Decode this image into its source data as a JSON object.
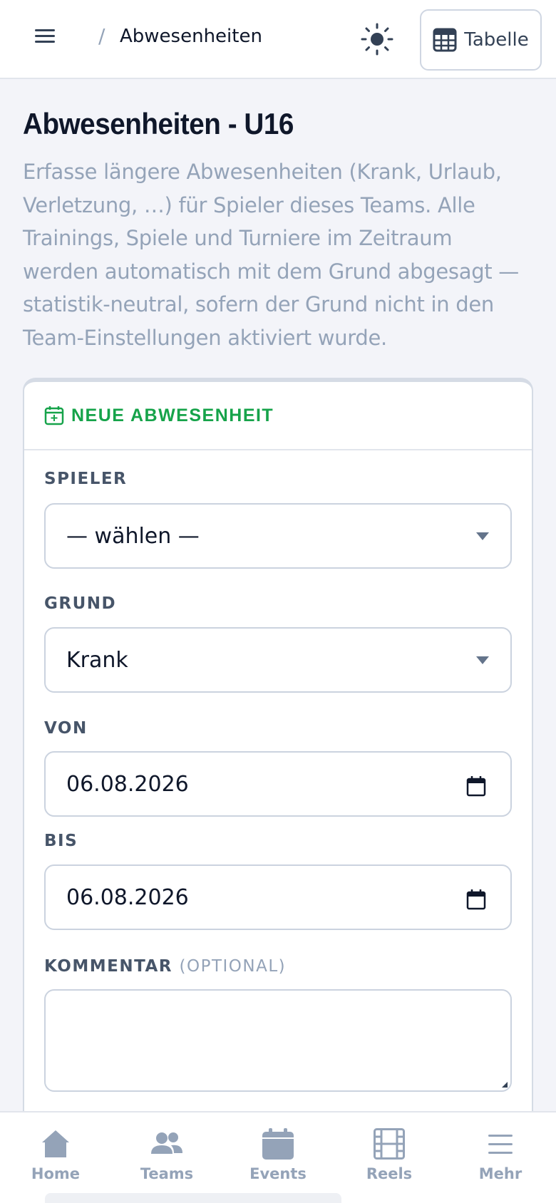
{
  "header": {
    "breadcrumb_sep": "/",
    "breadcrumb": "Abwesenheiten",
    "table_button": "Tabelle"
  },
  "page": {
    "title": "Abwesenheiten - U16",
    "intro": "Erfasse längere Abwesenheiten (Krank, Urlaub, Verletzung, …) für Spieler dieses Teams. Alle Trainings, Spiele und Turniere im Zeitraum werden automatisch mit dem Grund abgesagt — statistik-neutral, sofern der Grund nicht in den Team-Einstellungen aktiviert wurde."
  },
  "form": {
    "card_title": "NEUE ABWESENHEIT",
    "player_label": "SPIELER",
    "player_value": "— wählen —",
    "reason_label": "GRUND",
    "reason_value": "Krank",
    "from_label": "VON",
    "from_value": "06.08.2026",
    "to_label": "BIS",
    "to_value": "06.08.2026",
    "comment_label": "KOMMENTAR",
    "comment_optional": "(OPTIONAL)",
    "comment_value": ""
  },
  "nav": {
    "items": [
      {
        "label": "Home",
        "icon": "home-icon"
      },
      {
        "label": "Teams",
        "icon": "users-icon"
      },
      {
        "label": "Events",
        "icon": "calendar-icon"
      },
      {
        "label": "Reels",
        "icon": "film-icon"
      },
      {
        "label": "Mehr",
        "icon": "menu-icon"
      }
    ]
  },
  "colors": {
    "accent": "#16a34a",
    "muted": "#94a3b8",
    "background": "#f3f4f9"
  }
}
